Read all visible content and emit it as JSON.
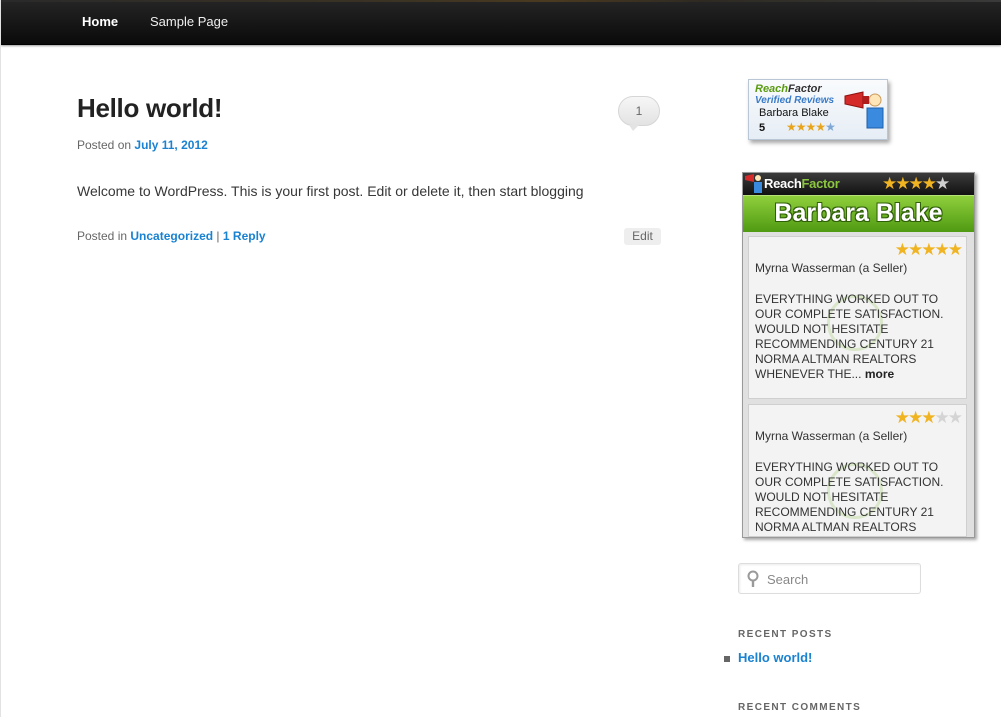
{
  "nav": {
    "items": [
      {
        "label": "Home"
      },
      {
        "label": "Sample Page"
      }
    ]
  },
  "post": {
    "title": "Hello world!",
    "comment_count": "1",
    "posted_on_prefix": "Posted on",
    "date": "July 11, 2012",
    "content": "Welcome to WordPress. This is your first post. Edit or delete it, then start blogging",
    "posted_in_prefix": "Posted in",
    "category": "Uncategorized",
    "separator": "|",
    "reply_link": "1 Reply",
    "edit_label": "Edit"
  },
  "rf_badge": {
    "logo_green": "Reach",
    "logo_dark": "Factor",
    "verified": "Verified Reviews",
    "agent": "Barbara Blake",
    "review_count": "5",
    "rating": 4
  },
  "rf_widget": {
    "logo_light": "Reach",
    "logo_green": "Factor",
    "rating": 4,
    "agent": "Barbara Blake",
    "reviews": [
      {
        "rating": 5,
        "reviewer": "Myrna Wasserman (a Seller)",
        "text": "EVERYTHING WORKED OUT TO OUR COMPLETE SATISFACTION. WOULD NOT HESITATE RECOMMENDING CENTURY 21 NORMA ALTMAN REALTORS WHENEVER THE...",
        "more": "more"
      },
      {
        "rating": 3,
        "reviewer": "Myrna Wasserman (a Seller)",
        "text": "EVERYTHING WORKED OUT TO OUR COMPLETE SATISFACTION. WOULD NOT HESITATE RECOMMENDING CENTURY 21 NORMA ALTMAN REALTORS"
      }
    ]
  },
  "search": {
    "placeholder": "Search"
  },
  "recent_posts": {
    "title": "RECENT POSTS",
    "items": [
      {
        "label": "Hello world!"
      }
    ]
  },
  "recent_comments": {
    "title": "RECENT COMMENTS"
  },
  "colors": {
    "link": "#1982d1",
    "star": "#f0b321",
    "green_bar": "#6cb52a"
  }
}
